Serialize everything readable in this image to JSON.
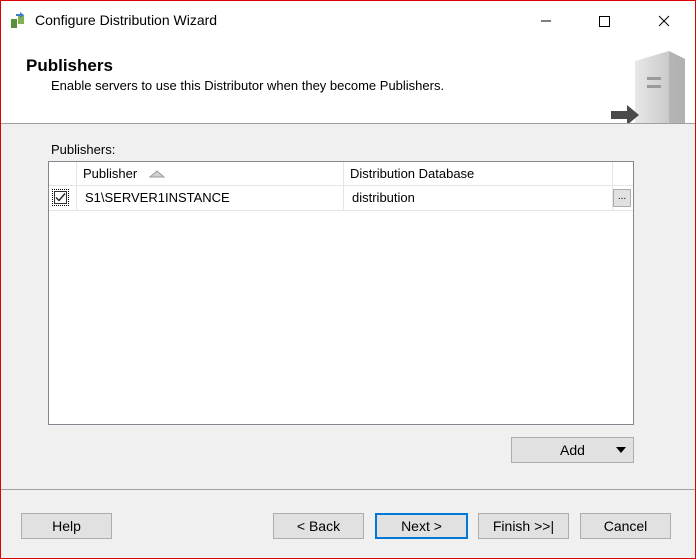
{
  "window": {
    "title": "Configure Distribution Wizard"
  },
  "header": {
    "title": "Publishers",
    "subtitle": "Enable servers to use this Distributor when they become Publishers."
  },
  "publishers": {
    "label": "Publishers:",
    "columns": [
      "Publisher",
      "Distribution Database"
    ],
    "rows": [
      {
        "checked": true,
        "publisher": "S1\\SERVER1INSTANCE",
        "database": "distribution",
        "browse": "..."
      }
    ],
    "add_label": "Add"
  },
  "footer": {
    "help": "Help",
    "back": "< Back",
    "next": "Next >",
    "finish": "Finish >>|",
    "cancel": "Cancel"
  },
  "colors": {
    "focus_border": "#0078d7",
    "window_border": "#e00000"
  }
}
